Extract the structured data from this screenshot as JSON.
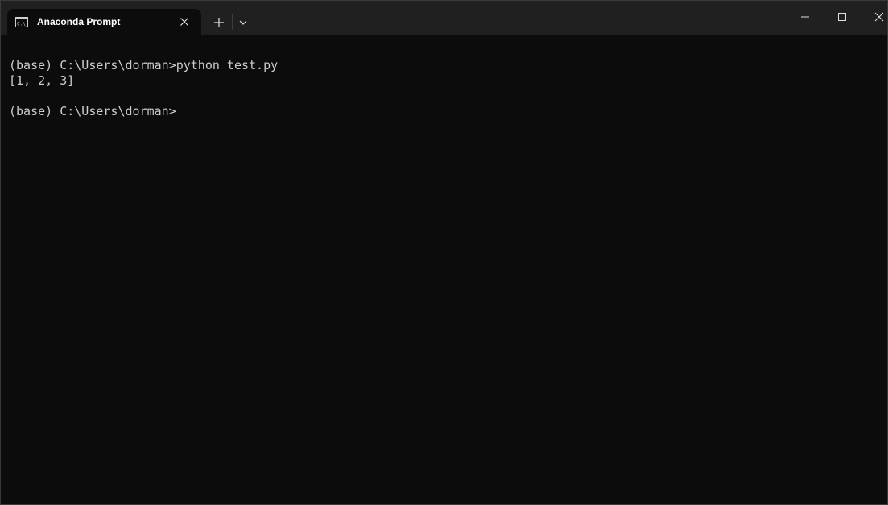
{
  "window": {
    "title": "Anaconda Prompt"
  },
  "tab": {
    "icon": "terminal-icon",
    "close_icon": "close-icon"
  },
  "toolbar": {
    "new_tab_icon": "plus-icon",
    "dropdown_icon": "chevron-down-icon"
  },
  "controls": {
    "minimize_icon": "minimize-icon",
    "maximize_icon": "maximize-icon",
    "close_icon": "close-icon"
  },
  "terminal": {
    "lines": [
      "(base) C:\\Users\\dorman>python test.py",
      "[1, 2, 3]",
      "",
      "(base) C:\\Users\\dorman>"
    ]
  },
  "colors": {
    "background": "#0c0c0c",
    "titlebar": "#202020",
    "text": "#cccccc"
  }
}
